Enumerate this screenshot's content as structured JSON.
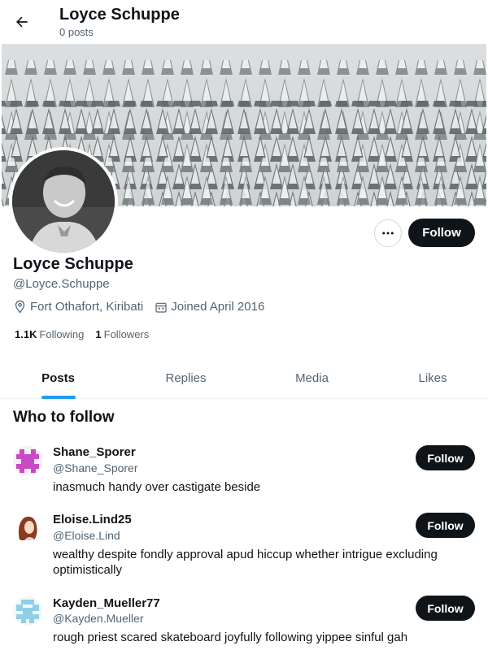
{
  "header": {
    "title": "Loyce Schuppe",
    "posts_count": "0 posts"
  },
  "profile": {
    "display_name": "Loyce Schuppe",
    "handle": "@Loyce.Schuppe",
    "location": "Fort Othafort, Kiribati",
    "joined": "Joined April 2016",
    "following_count": "1.1K",
    "following_label": "Following",
    "followers_count": "1",
    "followers_label": "Followers",
    "follow_label": "Follow"
  },
  "tabs": [
    {
      "label": "Posts",
      "active": true
    },
    {
      "label": "Replies",
      "active": false
    },
    {
      "label": "Media",
      "active": false
    },
    {
      "label": "Likes",
      "active": false
    }
  ],
  "who_to_follow": {
    "title": "Who to follow",
    "suggestions": [
      {
        "name": "Shane_Sporer",
        "handle": "@Shane_Sporer",
        "bio": "inasmuch handy over castigate beside",
        "follow_label": "Follow"
      },
      {
        "name": "Eloise.Lind25",
        "handle": "@Eloise.Lind",
        "bio": "wealthy despite fondly approval apud hiccup whether intrigue excluding optimistically",
        "follow_label": "Follow"
      },
      {
        "name": "Kayden_Mueller77",
        "handle": "@Kayden.Mueller",
        "bio": "rough priest scared skateboard joyfully following yippee sinful gah",
        "follow_label": "Follow"
      }
    ]
  },
  "colors": {
    "accent": "#1d9bf0",
    "text": "#0f1419",
    "muted": "#536471",
    "button": "#0f1419"
  }
}
